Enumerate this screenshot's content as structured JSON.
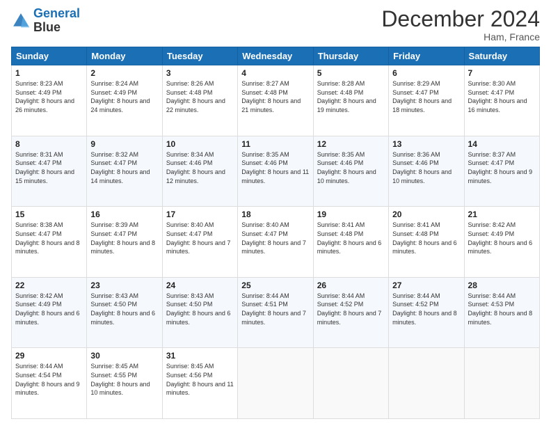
{
  "header": {
    "logo_line1": "General",
    "logo_line2": "Blue",
    "month": "December 2024",
    "location": "Ham, France"
  },
  "weekdays": [
    "Sunday",
    "Monday",
    "Tuesday",
    "Wednesday",
    "Thursday",
    "Friday",
    "Saturday"
  ],
  "weeks": [
    [
      {
        "day": "1",
        "sunrise": "8:23 AM",
        "sunset": "4:49 PM",
        "daylight": "8 hours and 26 minutes."
      },
      {
        "day": "2",
        "sunrise": "8:24 AM",
        "sunset": "4:49 PM",
        "daylight": "8 hours and 24 minutes."
      },
      {
        "day": "3",
        "sunrise": "8:26 AM",
        "sunset": "4:48 PM",
        "daylight": "8 hours and 22 minutes."
      },
      {
        "day": "4",
        "sunrise": "8:27 AM",
        "sunset": "4:48 PM",
        "daylight": "8 hours and 21 minutes."
      },
      {
        "day": "5",
        "sunrise": "8:28 AM",
        "sunset": "4:48 PM",
        "daylight": "8 hours and 19 minutes."
      },
      {
        "day": "6",
        "sunrise": "8:29 AM",
        "sunset": "4:47 PM",
        "daylight": "8 hours and 18 minutes."
      },
      {
        "day": "7",
        "sunrise": "8:30 AM",
        "sunset": "4:47 PM",
        "daylight": "8 hours and 16 minutes."
      }
    ],
    [
      {
        "day": "8",
        "sunrise": "8:31 AM",
        "sunset": "4:47 PM",
        "daylight": "8 hours and 15 minutes."
      },
      {
        "day": "9",
        "sunrise": "8:32 AM",
        "sunset": "4:47 PM",
        "daylight": "8 hours and 14 minutes."
      },
      {
        "day": "10",
        "sunrise": "8:34 AM",
        "sunset": "4:46 PM",
        "daylight": "8 hours and 12 minutes."
      },
      {
        "day": "11",
        "sunrise": "8:35 AM",
        "sunset": "4:46 PM",
        "daylight": "8 hours and 11 minutes."
      },
      {
        "day": "12",
        "sunrise": "8:35 AM",
        "sunset": "4:46 PM",
        "daylight": "8 hours and 10 minutes."
      },
      {
        "day": "13",
        "sunrise": "8:36 AM",
        "sunset": "4:46 PM",
        "daylight": "8 hours and 10 minutes."
      },
      {
        "day": "14",
        "sunrise": "8:37 AM",
        "sunset": "4:47 PM",
        "daylight": "8 hours and 9 minutes."
      }
    ],
    [
      {
        "day": "15",
        "sunrise": "8:38 AM",
        "sunset": "4:47 PM",
        "daylight": "8 hours and 8 minutes."
      },
      {
        "day": "16",
        "sunrise": "8:39 AM",
        "sunset": "4:47 PM",
        "daylight": "8 hours and 8 minutes."
      },
      {
        "day": "17",
        "sunrise": "8:40 AM",
        "sunset": "4:47 PM",
        "daylight": "8 hours and 7 minutes."
      },
      {
        "day": "18",
        "sunrise": "8:40 AM",
        "sunset": "4:47 PM",
        "daylight": "8 hours and 7 minutes."
      },
      {
        "day": "19",
        "sunrise": "8:41 AM",
        "sunset": "4:48 PM",
        "daylight": "8 hours and 6 minutes."
      },
      {
        "day": "20",
        "sunrise": "8:41 AM",
        "sunset": "4:48 PM",
        "daylight": "8 hours and 6 minutes."
      },
      {
        "day": "21",
        "sunrise": "8:42 AM",
        "sunset": "4:49 PM",
        "daylight": "8 hours and 6 minutes."
      }
    ],
    [
      {
        "day": "22",
        "sunrise": "8:42 AM",
        "sunset": "4:49 PM",
        "daylight": "8 hours and 6 minutes."
      },
      {
        "day": "23",
        "sunrise": "8:43 AM",
        "sunset": "4:50 PM",
        "daylight": "8 hours and 6 minutes."
      },
      {
        "day": "24",
        "sunrise": "8:43 AM",
        "sunset": "4:50 PM",
        "daylight": "8 hours and 6 minutes."
      },
      {
        "day": "25",
        "sunrise": "8:44 AM",
        "sunset": "4:51 PM",
        "daylight": "8 hours and 7 minutes."
      },
      {
        "day": "26",
        "sunrise": "8:44 AM",
        "sunset": "4:52 PM",
        "daylight": "8 hours and 7 minutes."
      },
      {
        "day": "27",
        "sunrise": "8:44 AM",
        "sunset": "4:52 PM",
        "daylight": "8 hours and 8 minutes."
      },
      {
        "day": "28",
        "sunrise": "8:44 AM",
        "sunset": "4:53 PM",
        "daylight": "8 hours and 8 minutes."
      }
    ],
    [
      {
        "day": "29",
        "sunrise": "8:44 AM",
        "sunset": "4:54 PM",
        "daylight": "8 hours and 9 minutes."
      },
      {
        "day": "30",
        "sunrise": "8:45 AM",
        "sunset": "4:55 PM",
        "daylight": "8 hours and 10 minutes."
      },
      {
        "day": "31",
        "sunrise": "8:45 AM",
        "sunset": "4:56 PM",
        "daylight": "8 hours and 11 minutes."
      },
      null,
      null,
      null,
      null
    ]
  ]
}
